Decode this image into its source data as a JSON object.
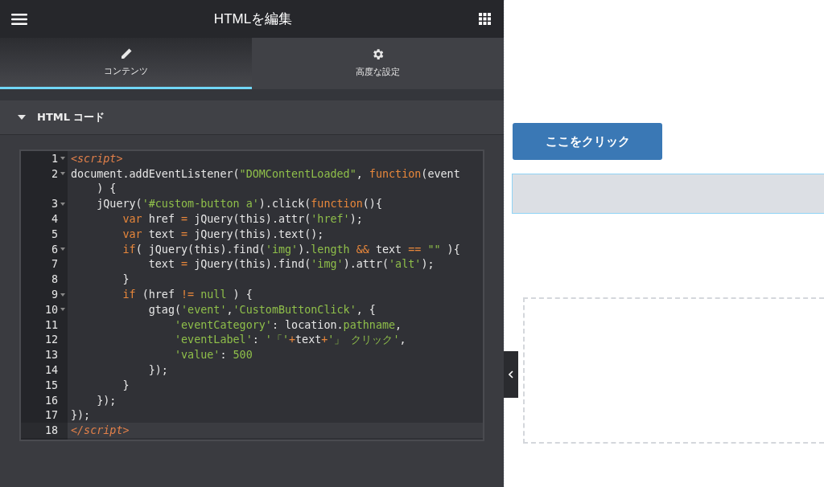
{
  "header": {
    "title": "HTMLを編集"
  },
  "tabs": [
    {
      "label": "コンテンツ",
      "selected": true
    },
    {
      "label": "高度な設定",
      "selected": false
    }
  ],
  "section": {
    "title": "HTML コード",
    "expanded": true
  },
  "code_lines": [
    {
      "n": "1",
      "fold": true,
      "active": false,
      "tokens": [
        {
          "t": "<script>",
          "kind": "tag"
        }
      ]
    },
    {
      "n": "2",
      "fold": true,
      "active": false,
      "tokens": [
        {
          "t": "document.addEventListener(",
          "kind": "plain"
        },
        {
          "t": "\"DOMContentLoaded\"",
          "kind": "str"
        },
        {
          "t": ", ",
          "kind": "plain"
        },
        {
          "t": "function",
          "kind": "kw"
        },
        {
          "t": "(event",
          "kind": "plain"
        }
      ],
      "cont": [
        {
          "t": "    ) {",
          "kind": "plain"
        }
      ]
    },
    {
      "n": "3",
      "fold": true,
      "active": false,
      "tokens": [
        {
          "t": "    jQuery(",
          "kind": "plain"
        },
        {
          "t": "'#custom-button a'",
          "kind": "str"
        },
        {
          "t": ").click(",
          "kind": "plain"
        },
        {
          "t": "function",
          "kind": "kw"
        },
        {
          "t": "(){",
          "kind": "plain"
        }
      ]
    },
    {
      "n": "4",
      "fold": false,
      "active": false,
      "tokens": [
        {
          "t": "        var",
          "kind": "kw"
        },
        {
          "t": " href ",
          "kind": "plain"
        },
        {
          "t": "=",
          "kind": "kw"
        },
        {
          "t": " jQuery(this).attr(",
          "kind": "plain"
        },
        {
          "t": "'href'",
          "kind": "str"
        },
        {
          "t": ");",
          "kind": "plain"
        }
      ]
    },
    {
      "n": "5",
      "fold": false,
      "active": false,
      "tokens": [
        {
          "t": "        var",
          "kind": "kw"
        },
        {
          "t": " text ",
          "kind": "plain"
        },
        {
          "t": "=",
          "kind": "kw"
        },
        {
          "t": " jQuery(this).text();",
          "kind": "plain"
        }
      ]
    },
    {
      "n": "6",
      "fold": true,
      "active": false,
      "tokens": [
        {
          "t": "        if",
          "kind": "kw"
        },
        {
          "t": "( jQuery(this).find(",
          "kind": "plain"
        },
        {
          "t": "'img'",
          "kind": "str"
        },
        {
          "t": ").",
          "kind": "plain"
        },
        {
          "t": "length",
          "kind": "str"
        },
        {
          "t": " &&",
          "kind": "kw"
        },
        {
          "t": " text ",
          "kind": "plain"
        },
        {
          "t": "==",
          "kind": "kw"
        },
        {
          "t": " \"\"",
          "kind": "str"
        },
        {
          "t": " ){",
          "kind": "plain"
        }
      ]
    },
    {
      "n": "7",
      "fold": false,
      "active": false,
      "tokens": [
        {
          "t": "            text ",
          "kind": "plain"
        },
        {
          "t": "=",
          "kind": "kw"
        },
        {
          "t": " jQuery(this).find(",
          "kind": "plain"
        },
        {
          "t": "'img'",
          "kind": "str"
        },
        {
          "t": ").attr(",
          "kind": "plain"
        },
        {
          "t": "'alt'",
          "kind": "str"
        },
        {
          "t": ");",
          "kind": "plain"
        }
      ]
    },
    {
      "n": "8",
      "fold": false,
      "active": false,
      "tokens": [
        {
          "t": "        }",
          "kind": "plain"
        }
      ]
    },
    {
      "n": "9",
      "fold": true,
      "active": false,
      "tokens": [
        {
          "t": "        if",
          "kind": "kw"
        },
        {
          "t": " (href ",
          "kind": "plain"
        },
        {
          "t": "!=",
          "kind": "kw"
        },
        {
          "t": " null",
          "kind": "str"
        },
        {
          "t": " ) {",
          "kind": "plain"
        }
      ]
    },
    {
      "n": "10",
      "fold": true,
      "active": false,
      "tokens": [
        {
          "t": "            gtag(",
          "kind": "plain"
        },
        {
          "t": "'event'",
          "kind": "str"
        },
        {
          "t": ",",
          "kind": "plain"
        },
        {
          "t": "'CustomButtonClick'",
          "kind": "str"
        },
        {
          "t": ", {",
          "kind": "plain"
        }
      ]
    },
    {
      "n": "11",
      "fold": false,
      "active": false,
      "tokens": [
        {
          "t": "                'eventCategory'",
          "kind": "str"
        },
        {
          "t": ": location.",
          "kind": "plain"
        },
        {
          "t": "pathname",
          "kind": "str"
        },
        {
          "t": ",",
          "kind": "plain"
        }
      ]
    },
    {
      "n": "12",
      "fold": false,
      "active": false,
      "tokens": [
        {
          "t": "                'eventLabel'",
          "kind": "str"
        },
        {
          "t": ": ",
          "kind": "plain"
        },
        {
          "t": "'「'",
          "kind": "str"
        },
        {
          "t": "+",
          "kind": "kw"
        },
        {
          "t": "text",
          "kind": "plain"
        },
        {
          "t": "+",
          "kind": "kw"
        },
        {
          "t": "'」 クリック'",
          "kind": "str"
        },
        {
          "t": ",",
          "kind": "plain"
        }
      ]
    },
    {
      "n": "13",
      "fold": false,
      "active": false,
      "tokens": [
        {
          "t": "                'value'",
          "kind": "str"
        },
        {
          "t": ": ",
          "kind": "plain"
        },
        {
          "t": "500",
          "kind": "str"
        }
      ]
    },
    {
      "n": "14",
      "fold": false,
      "active": false,
      "tokens": [
        {
          "t": "            });",
          "kind": "plain"
        }
      ]
    },
    {
      "n": "15",
      "fold": false,
      "active": false,
      "tokens": [
        {
          "t": "        }",
          "kind": "plain"
        }
      ]
    },
    {
      "n": "16",
      "fold": false,
      "active": false,
      "tokens": [
        {
          "t": "    });",
          "kind": "plain"
        }
      ]
    },
    {
      "n": "17",
      "fold": false,
      "active": false,
      "tokens": [
        {
          "t": "});",
          "kind": "plain"
        }
      ]
    },
    {
      "n": "18",
      "fold": false,
      "active": true,
      "tokens": [
        {
          "t": "</script>",
          "kind": "tag"
        }
      ]
    }
  ],
  "preview": {
    "button": "ここをクリック"
  }
}
